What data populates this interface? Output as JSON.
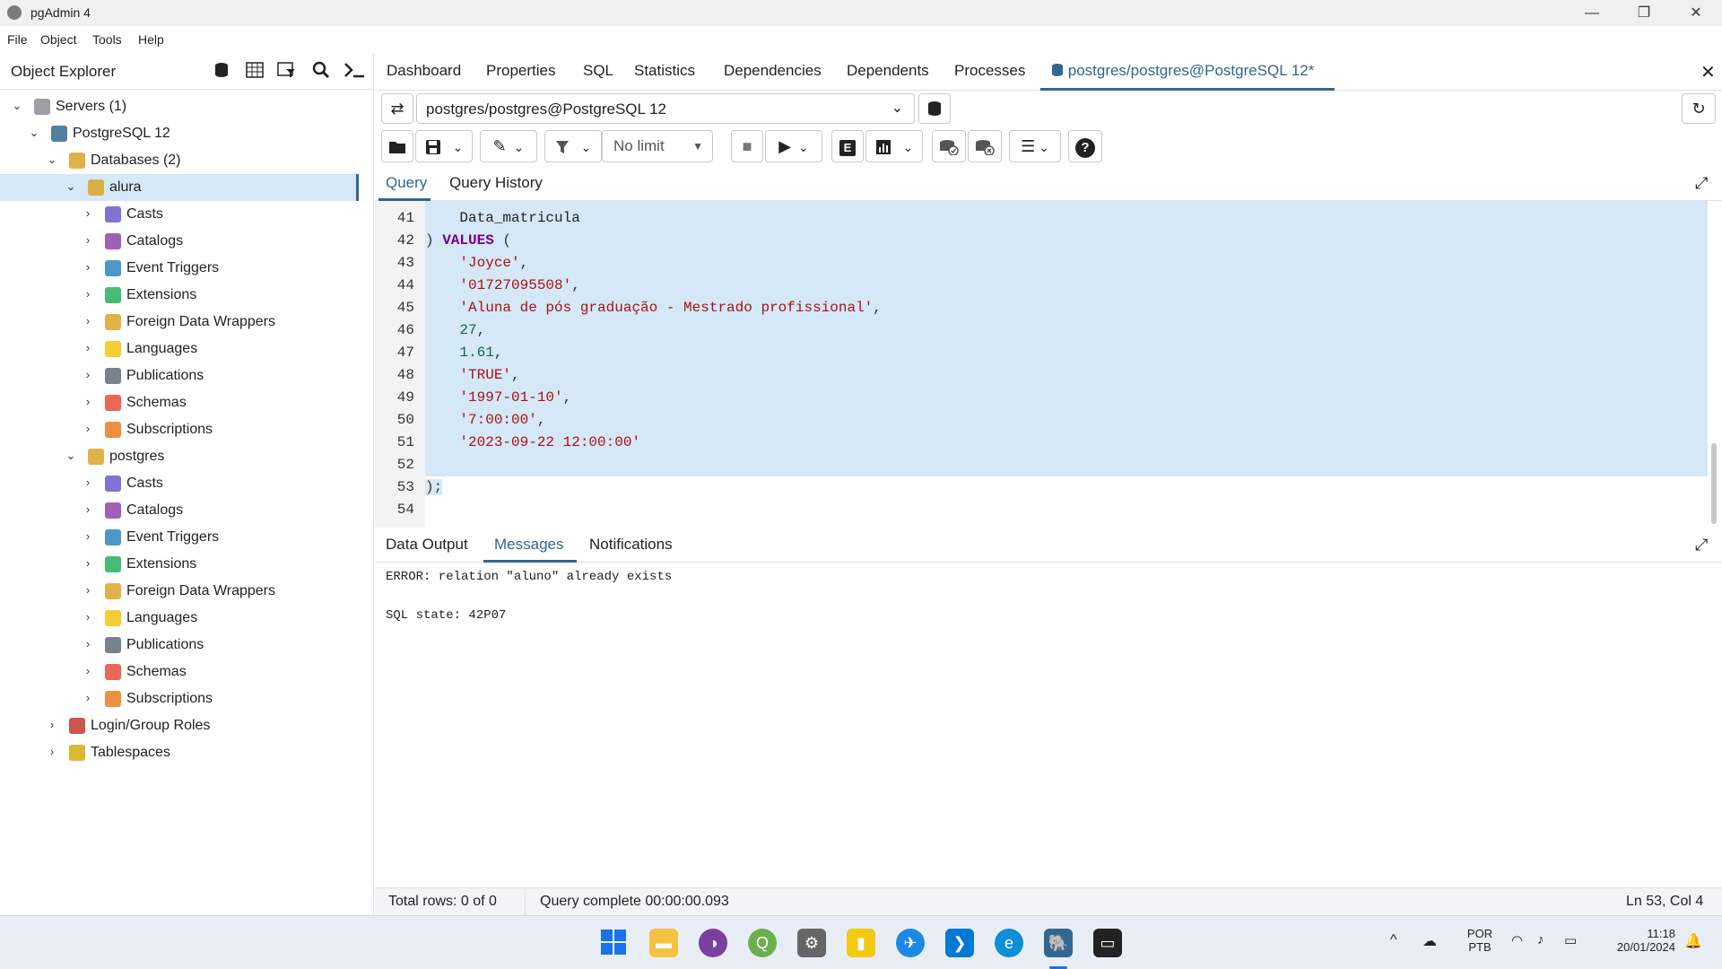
{
  "window": {
    "title": "pgAdmin 4",
    "minimize": "—",
    "restore": "❐",
    "close": "✕"
  },
  "menu": [
    "File",
    "Object",
    "Tools",
    "Help"
  ],
  "object_explorer": {
    "title": "Object Explorer",
    "tree": [
      {
        "label": "Servers (1)",
        "chev": "⌄",
        "icon": "servers-icon"
      },
      {
        "label": "PostgreSQL 12",
        "chev": "⌄",
        "icon": "elephant-icon"
      },
      {
        "label": "Databases (2)",
        "chev": "⌄",
        "icon": "databases-icon"
      },
      {
        "label": "alura",
        "chev": "⌄",
        "icon": "database-icon",
        "selected": true
      },
      {
        "label": "Casts",
        "chev": "›",
        "icon": "casts-icon"
      },
      {
        "label": "Catalogs",
        "chev": "›",
        "icon": "catalogs-icon"
      },
      {
        "label": "Event Triggers",
        "chev": "›",
        "icon": "event-triggers-icon"
      },
      {
        "label": "Extensions",
        "chev": "›",
        "icon": "extensions-icon"
      },
      {
        "label": "Foreign Data Wrappers",
        "chev": "›",
        "icon": "fdw-icon"
      },
      {
        "label": "Languages",
        "chev": "›",
        "icon": "languages-icon"
      },
      {
        "label": "Publications",
        "chev": "›",
        "icon": "publications-icon"
      },
      {
        "label": "Schemas",
        "chev": "›",
        "icon": "schemas-icon"
      },
      {
        "label": "Subscriptions",
        "chev": "›",
        "icon": "subscriptions-icon"
      },
      {
        "label": "postgres",
        "chev": "⌄",
        "icon": "database-icon"
      },
      {
        "label": "Casts",
        "chev": "›",
        "icon": "casts-icon"
      },
      {
        "label": "Catalogs",
        "chev": "›",
        "icon": "catalogs-icon"
      },
      {
        "label": "Event Triggers",
        "chev": "›",
        "icon": "event-triggers-icon"
      },
      {
        "label": "Extensions",
        "chev": "›",
        "icon": "extensions-icon"
      },
      {
        "label": "Foreign Data Wrappers",
        "chev": "›",
        "icon": "fdw-icon"
      },
      {
        "label": "Languages",
        "chev": "›",
        "icon": "languages-icon"
      },
      {
        "label": "Publications",
        "chev": "›",
        "icon": "publications-icon"
      },
      {
        "label": "Schemas",
        "chev": "›",
        "icon": "schemas-icon"
      },
      {
        "label": "Subscriptions",
        "chev": "›",
        "icon": "subscriptions-icon"
      },
      {
        "label": "Login/Group Roles",
        "chev": "›",
        "icon": "roles-icon"
      },
      {
        "label": "Tablespaces",
        "chev": "›",
        "icon": "tablespaces-icon"
      }
    ]
  },
  "tabs": [
    "Dashboard",
    "Properties",
    "SQL",
    "Statistics",
    "Dependencies",
    "Dependents",
    "Processes",
    "postgres/postgres@PostgreSQL 12*"
  ],
  "connection": {
    "value": "postgres/postgres@PostgreSQL 12"
  },
  "limit": {
    "value": "No limit"
  },
  "query_tabs": [
    "Query",
    "Query History"
  ],
  "editor": {
    "lines": [
      {
        "n": "41",
        "parts": [
          {
            "t": "    Data_matricula",
            "c": "plain"
          }
        ]
      },
      {
        "n": "42",
        "parts": [
          {
            "t": ") ",
            "c": "punct"
          },
          {
            "t": "VALUES",
            "c": "kw"
          },
          {
            "t": " (",
            "c": "punct"
          }
        ]
      },
      {
        "n": "43",
        "parts": [
          {
            "t": "    ",
            "c": "plain"
          },
          {
            "t": "'Joyce'",
            "c": "str"
          },
          {
            "t": ",",
            "c": "punct"
          }
        ]
      },
      {
        "n": "44",
        "parts": [
          {
            "t": "    ",
            "c": "plain"
          },
          {
            "t": "'01727095508'",
            "c": "str"
          },
          {
            "t": ",",
            "c": "punct"
          }
        ]
      },
      {
        "n": "45",
        "parts": [
          {
            "t": "    ",
            "c": "plain"
          },
          {
            "t": "'Aluna de pós graduação - Mestrado profissional'",
            "c": "str"
          },
          {
            "t": ",",
            "c": "punct"
          }
        ]
      },
      {
        "n": "46",
        "parts": [
          {
            "t": "    ",
            "c": "plain"
          },
          {
            "t": "27",
            "c": "num"
          },
          {
            "t": ",",
            "c": "punct"
          }
        ]
      },
      {
        "n": "47",
        "parts": [
          {
            "t": "    ",
            "c": "plain"
          },
          {
            "t": "1.61",
            "c": "num"
          },
          {
            "t": ",",
            "c": "punct"
          }
        ]
      },
      {
        "n": "48",
        "parts": [
          {
            "t": "    ",
            "c": "plain"
          },
          {
            "t": "'TRUE'",
            "c": "str"
          },
          {
            "t": ",",
            "c": "punct"
          }
        ]
      },
      {
        "n": "49",
        "parts": [
          {
            "t": "    ",
            "c": "plain"
          },
          {
            "t": "'1997-01-10'",
            "c": "str"
          },
          {
            "t": ",",
            "c": "punct"
          }
        ]
      },
      {
        "n": "50",
        "parts": [
          {
            "t": "    ",
            "c": "plain"
          },
          {
            "t": "'7:00:00'",
            "c": "str"
          },
          {
            "t": ",",
            "c": "punct"
          }
        ]
      },
      {
        "n": "51",
        "parts": [
          {
            "t": "    ",
            "c": "plain"
          },
          {
            "t": "'2023-09-22 12:00:00'",
            "c": "str"
          }
        ]
      },
      {
        "n": "52",
        "parts": [
          {
            "t": "",
            "c": "plain"
          }
        ]
      },
      {
        "n": "53",
        "parts": [
          {
            "t": ");",
            "c": "punct"
          }
        ]
      },
      {
        "n": "54",
        "parts": [
          {
            "t": "",
            "c": "plain"
          }
        ]
      }
    ]
  },
  "result_tabs": [
    "Data Output",
    "Messages",
    "Notifications"
  ],
  "messages": {
    "error": "ERROR:  relation \"aluno\" already exists",
    "state": "SQL state: 42P07"
  },
  "status": {
    "rows": "Total rows: 0 of 0",
    "query": "Query complete 00:00:00.093",
    "position": "Ln 53, Col 4"
  },
  "taskbar": {
    "lang1": "POR",
    "lang2": "PTB",
    "time": "11:18",
    "date": "20/01/2024"
  },
  "colors": {
    "accent": "#326690",
    "selection": "#d5e8f7"
  }
}
